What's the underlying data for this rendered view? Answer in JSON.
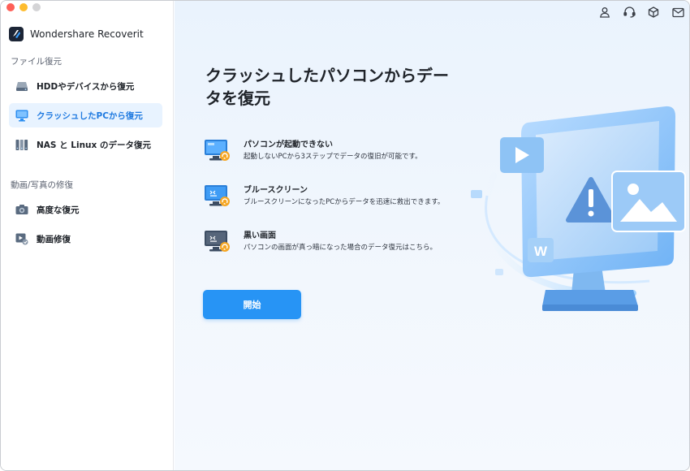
{
  "window": {
    "traffic_lights": [
      "close",
      "minimize",
      "zoom"
    ]
  },
  "app": {
    "name": "Wondershare Recoverit",
    "logo_icon": "recoverit-logo-icon"
  },
  "sidebar": {
    "sections": [
      {
        "title": "ファイル復元",
        "items": [
          {
            "label": "HDDやデバイスから復元",
            "icon": "hdd-icon",
            "active": false
          },
          {
            "label": "クラッシュしたPCから復元",
            "icon": "monitor-icon",
            "active": true
          },
          {
            "label": "NAS と Linux のデータ復元",
            "icon": "nas-icon",
            "active": false
          }
        ]
      },
      {
        "title": "動画/写真の修復",
        "items": [
          {
            "label": "高度な復元",
            "icon": "camera-icon",
            "active": false
          },
          {
            "label": "動画修復",
            "icon": "video-repair-icon",
            "active": false
          }
        ]
      }
    ]
  },
  "header": {
    "icons": [
      "user-icon",
      "headset-icon",
      "box-icon",
      "mail-icon"
    ]
  },
  "main": {
    "headline_line1": "クラッシュしたパソコンからデー",
    "headline_line2": "タを復元",
    "features": [
      {
        "title": "パソコンが起動できない",
        "description": "起動しないPCから3ステップでデータの復旧が可能です。",
        "icon": "blue-monitor-icon"
      },
      {
        "title": "ブルースクリーン",
        "description": "ブルースクリーンになったPCからデータを迅速に救出できます。",
        "icon": "bluescreen-monitor-icon"
      },
      {
        "title": "黒い画面",
        "description": "パソコンの画面が真っ暗になった場合のデータ復元はこちら。",
        "icon": "blackscreen-monitor-icon"
      }
    ],
    "start_button": "開始"
  },
  "colors": {
    "accent": "#2794f5",
    "active_bg": "#e8f3ff",
    "active_text": "#1f7ae0"
  }
}
